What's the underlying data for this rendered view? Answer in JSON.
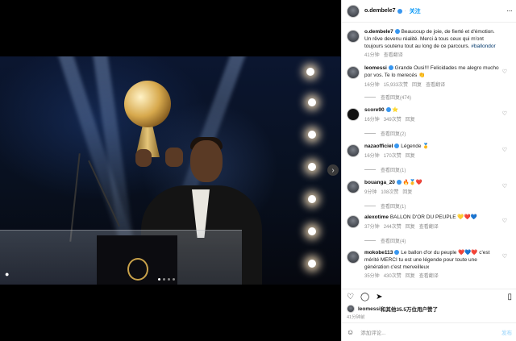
{
  "post": {
    "author": "o.dembele7",
    "follow_label": "关注",
    "more_glyph": "···",
    "caption_text": "Beaucoup de joie, de fierté et d'émotion. Un rêve devenu réalité. Merci à tous ceux qui m'ont toujours soutenu tout au long de ce parcours.",
    "caption_hashtag": "#ballondor",
    "caption_time": "41分钟",
    "caption_translate": "查看翻译"
  },
  "comments": [
    {
      "user": "leomessi",
      "text": "Grande Ousi!!! Felicidades me alegro mucho por vos. Te lo merecés 👏",
      "time": "16分钟",
      "likes": "15,933次赞",
      "reply": "回复",
      "translate": "查看翻译",
      "replies": "查看回复(474)"
    },
    {
      "user": "score90",
      "text": "⭐",
      "time": "16分钟",
      "likes": "349次赞",
      "reply": "回复",
      "translate": "",
      "replies": "查看回复(2)"
    },
    {
      "user": "nazaofficiel",
      "text": "Légende 🥇",
      "time": "16分钟",
      "likes": "170次赞",
      "reply": "回复",
      "translate": "",
      "replies": "查看回复(1)"
    },
    {
      "user": "bouanga_20",
      "text": "🔥🥇❤️",
      "time": "9分钟",
      "likes": "108次赞",
      "reply": "回复",
      "translate": "",
      "replies": "查看回复(1)"
    },
    {
      "user": "alexotime",
      "text": "BALLON D'OR DU PEUPLE 💛❤️💙",
      "time": "37分钟",
      "likes": "244次赞",
      "reply": "回复",
      "translate": "查看翻译",
      "replies": "查看回复(4)"
    },
    {
      "user": "mokobe113",
      "text": "Le ballon d'or du peuple ❤️💙❤️ c'est mérité MERCI tu est une légende pour toute une génération c'est merveilleux",
      "time": "35分钟",
      "likes": "430次赞",
      "reply": "回复",
      "translate": "查看翻译",
      "replies": ""
    }
  ],
  "likes_line": {
    "user": "leomessi",
    "suffix": "和其他35.5万位用户赞了"
  },
  "posted_time": "41分钟前",
  "composer": {
    "placeholder": "添加评论...",
    "post_label": "发布"
  },
  "icons": [
    "heart-icon",
    "comment-icon",
    "share-icon",
    "bookmark-icon",
    "emoji-icon",
    "verified-icon",
    "next-arrow-icon",
    "user-tag-icon",
    "more-icon"
  ]
}
